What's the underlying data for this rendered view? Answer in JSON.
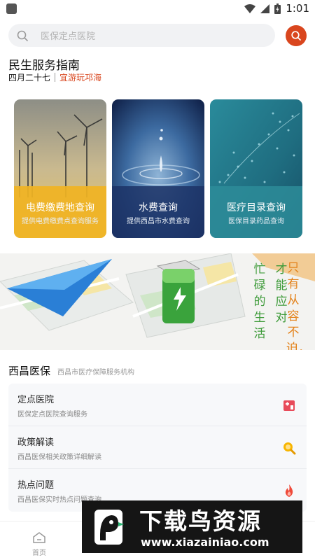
{
  "status_bar": {
    "time": "1:01"
  },
  "search": {
    "placeholder": "医保定点医院"
  },
  "header": {
    "title": "民生服务指南",
    "date": "四月二十七",
    "festival": "宜游玩邛海"
  },
  "cards": [
    {
      "title": "电费缴费地查询",
      "subtitle": "提供电费缴费点查询服务",
      "overlay_color": "#f0b323"
    },
    {
      "title": "水费查询",
      "subtitle": "提供西昌市水费查询",
      "overlay_color": "#1f3a74"
    },
    {
      "title": "医疗目录查询",
      "subtitle": "医保目录药品查询",
      "overlay_color": "#2d8c99"
    }
  ],
  "banner": {
    "col1": "忙碌的生活",
    "col2": "才能应对",
    "col3": "只有从容不迫，"
  },
  "section": {
    "title": "西昌医保",
    "subtitle": "西昌市医疗保障服务机构"
  },
  "list_items": [
    {
      "title": "定点医院",
      "desc": "医保定点医院查询服务",
      "icon": "hospital-icon"
    },
    {
      "title": "政策解读",
      "desc": "西昌医保相关政策详细解读",
      "icon": "magnifier-icon"
    },
    {
      "title": "热点问题",
      "desc": "西昌医保实时热点问题查询",
      "icon": "flame-icon"
    }
  ],
  "bottom_nav": {
    "home_label": "首页"
  },
  "watermark": {
    "title": "下载鸟资源",
    "url": "www.xiazainiao.com"
  },
  "colors": {
    "accent": "#d9461e",
    "banner_green": "#3e9b3a",
    "banner_orange": "#e3821a"
  }
}
